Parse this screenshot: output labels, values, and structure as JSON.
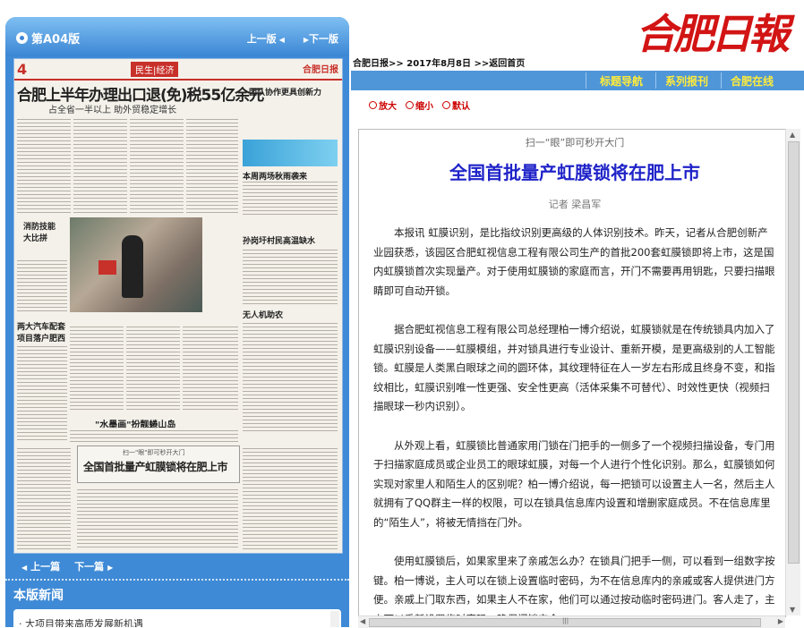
{
  "left": {
    "edition": "第A04版",
    "prev_edition": "上一版",
    "next_edition": "下一版",
    "paper": {
      "page_num": "4",
      "section": "民生|经济",
      "logo": "合肥日报",
      "headline": "合肥上半年办理出口退(免)税55亿余元",
      "subhead": "占全省一半以上 助外贸稳定增长",
      "side_head": "团队协作更具创新力",
      "head_a": "本周两场秋雨袭来",
      "head_b": "孙岗圩村民高温缺水",
      "head_c": "消防技能大比拼",
      "head_d": "两大汽车配套项目落户肥西",
      "head_e": "无人机助农",
      "head_f": "\"水墨画\"扮靓蜷山岛",
      "box_kicker": "扫一\"眼\"即可秒开大门",
      "box_title": "全国首批量产虹膜锁将在肥上市"
    },
    "prev_article": "上一篇",
    "next_article": "下一篇",
    "section_news": "本版新闻",
    "news_item": "· 大项目带来高质发展新机遇"
  },
  "masthead": "合肥日報",
  "breadcrumb": "合肥日报>> 2017年8月8日 >>返回首页",
  "nav": [
    "标题导航",
    "系列报刊",
    "合肥在线"
  ],
  "tools": {
    "zoom_in": "放大",
    "zoom_out": "缩小",
    "default": "默认"
  },
  "article": {
    "kicker": "扫一“眼”即可秒开大门",
    "title": "全国首批量产虹膜锁将在肥上市",
    "author": "记者 梁昌军",
    "paragraphs": [
      "本报讯 虹膜识别，是比指纹识别更高级的人体识别技术。昨天，记者从合肥创新产业园获悉，该园区合肥虹视信息工程有限公司生产的首批200套虹膜锁即将上市，这是国内虹膜锁首次实现量产。对于使用虹膜锁的家庭而言，开门不需要再用钥匙，只要扫描眼睛即可自动开锁。",
      "据合肥虹视信息工程有限公司总经理柏一博介绍说，虹膜锁就是在传统锁具内加入了虹膜识别设备——虹膜模组，并对锁具进行专业设计、重新开模，是更高级别的人工智能锁。虹膜是人类黑白眼球之间的圆环体，其纹理特征在人一岁左右形成且终身不变，和指纹相比，虹膜识别唯一性更强、安全性更高（活体采集不可替代）、时效性更快（视频扫描眼球一秒内识别）。",
      "从外观上看，虹膜锁比普通家用门锁在门把手的一侧多了一个视频扫描设备，专门用于扫描家庭成员或企业员工的眼球虹膜，对每一个人进行个性化识别。那么，虹膜锁如何实现对家里人和陌生人的区别呢？柏一博介绍说，每一把锁可以设置主人一名，然后主人就拥有了QQ群主一样的权限，可以在锁具信息库内设置和增删家庭成员。不在信息库里的“陌生人”，将被无情挡在门外。",
      "使用虹膜锁后，如果家里来了亲戚怎么办？在锁具门把手一侧，可以看到一组数字按键。柏一博说，主人可以在锁上设置临时密码，为不在信息库内的亲戚或客人提供进门方便。亲戚上门取东西，如果主人不在家，他们可以通过按动临时密码进门。客人走了，主人可以重新设置临时密码，确保门锁安全。"
    ]
  }
}
